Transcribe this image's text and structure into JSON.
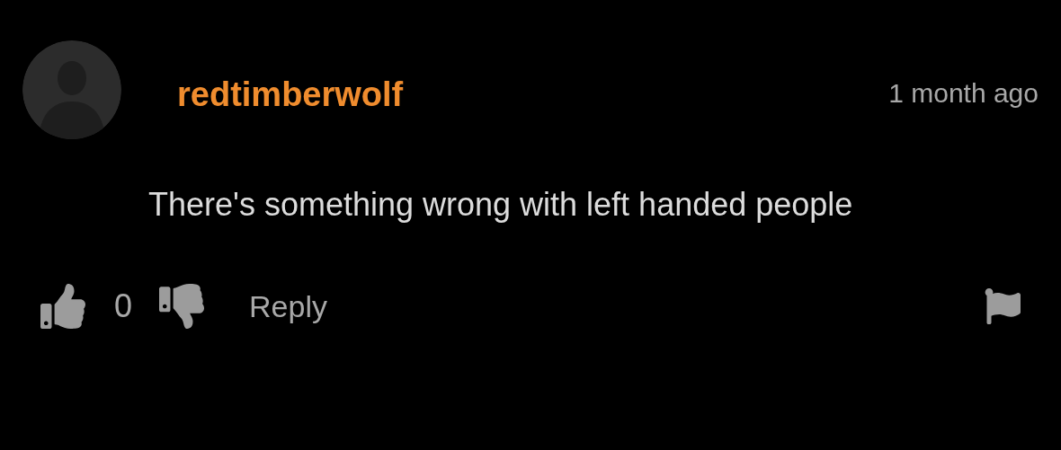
{
  "comment": {
    "username": "redtimberwolf",
    "time": "1 month ago",
    "text": "There's something wrong with left handed people",
    "likes": "0",
    "reply": "Reply"
  }
}
